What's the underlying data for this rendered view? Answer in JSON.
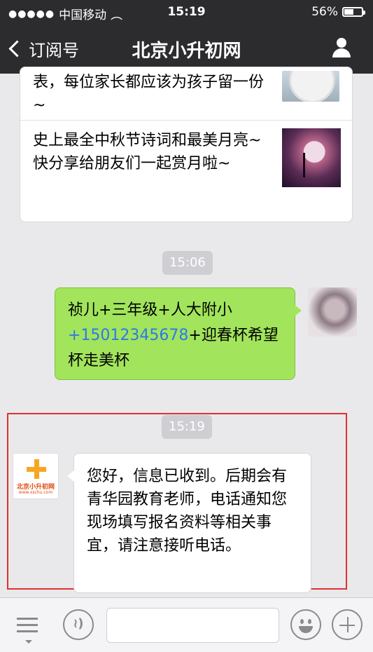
{
  "status_bar": {
    "signal_dots": "●●●●●",
    "carrier": "中国移动",
    "wifi_glyph": "︵",
    "time": "15:19",
    "battery": "56%",
    "battery_level": 0.56
  },
  "nav": {
    "back_label": "订阅号",
    "title": "北京小升初网",
    "profile_icon": "user-icon"
  },
  "articles": [
    {
      "title": "表，每位家长都应该为孩子留一份~",
      "thumb_icon": "clock-thumbnail"
    },
    {
      "title": "史上最全中秋节诗词和最美月亮~快分享给朋友们一起赏月啦~",
      "thumb_icon": "moon-tree-thumbnail"
    }
  ],
  "messages": [
    {
      "type": "time",
      "text": "15:06"
    },
    {
      "type": "sent",
      "parts": [
        "祯儿+三年级+人大附小",
        "+15012345678",
        "+迎春杯希望杯走美杯"
      ]
    },
    {
      "type": "time",
      "text": "15:19"
    },
    {
      "type": "received",
      "logo_text": "北京小升初网",
      "logo_sub": "www.xschu.com",
      "text": "您好，信息已收到。后期会有青华园教育老师，电话通知您现场填写报名资料等相关事宜，请注意接听电话。"
    }
  ],
  "input_bar": {
    "menu_icon": "menu-icon",
    "voice_icon": "voice-icon",
    "emoji_icon": "emoji-icon",
    "plus_icon": "plus-icon",
    "text_value": ""
  },
  "colors": {
    "topbar": "#2c2c2f",
    "sent_bubble": "#a2e45c",
    "link_blue": "#2c7ae8",
    "highlight_border": "#e0312d"
  }
}
